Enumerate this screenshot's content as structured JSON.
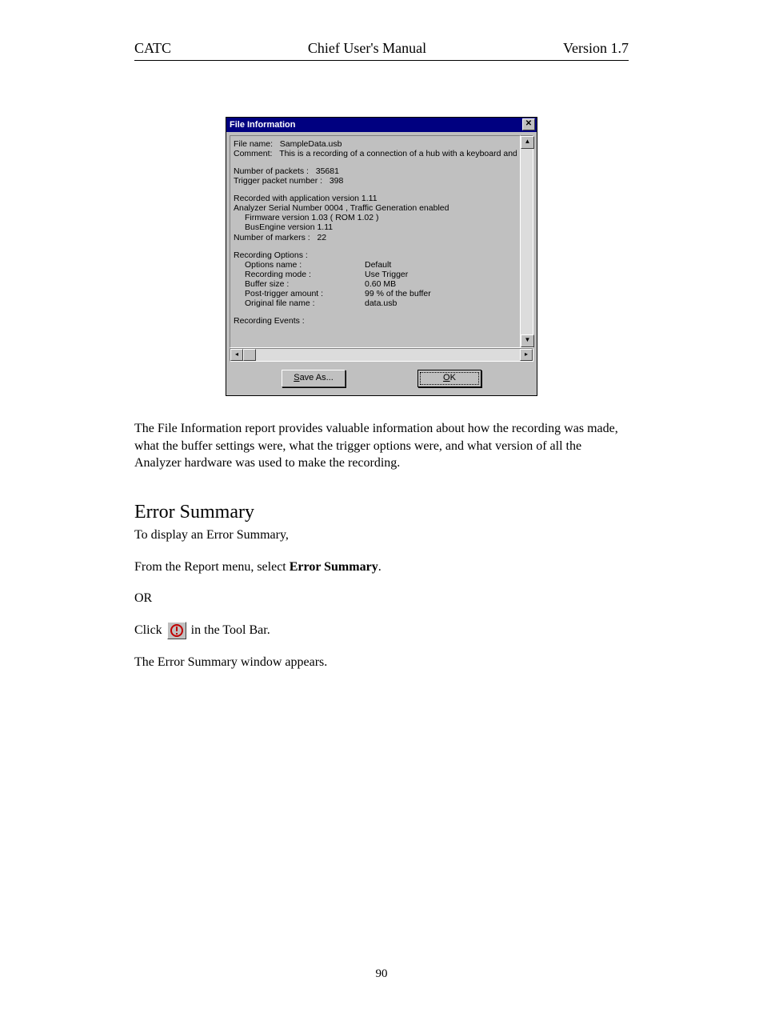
{
  "header": {
    "left": "CATC",
    "center": "Chief User's Manual",
    "right": "Version 1.7"
  },
  "dialog": {
    "title": "File Information",
    "close_glyph": "✕",
    "file_name_label": "File name:",
    "file_name_value": "SampleData.usb",
    "comment_label": "Comment:",
    "comment_value": "This is a recording of a connection of a hub with a keyboard and M",
    "num_packets_label": "Number of packets :",
    "num_packets_value": "35681",
    "trigger_packet_label": "Trigger packet number :",
    "trigger_packet_value": "398",
    "recorded_with": "Recorded with application version 1.11",
    "analyzer_serial": "Analyzer Serial Number 0004 ,  Traffic Generation enabled",
    "firmware": "Firmware version 1.03 ( ROM 1.02 )",
    "busengine": "BusEngine version 1.11",
    "num_markers_label": "Number of markers :",
    "num_markers_value": "22",
    "rec_options_header": "Recording Options :",
    "opt_options_name_label": "Options name :",
    "opt_options_name_value": "Default",
    "opt_recording_mode_label": "Recording mode :",
    "opt_recording_mode_value": "Use Trigger",
    "opt_buffer_size_label": "Buffer size :",
    "opt_buffer_size_value": "0.60 MB",
    "opt_post_trigger_label": "Post-trigger amount :",
    "opt_post_trigger_value": "99 % of the buffer",
    "opt_orig_file_label": "Original file name :",
    "opt_orig_file_value": "data.usb",
    "rec_events_header": "Recording Events :",
    "btn_save_as_prefix": "S",
    "btn_save_as_rest": "ave As...",
    "btn_ok_prefix": "O",
    "btn_ok_rest": "K",
    "scroll_up": "▲",
    "scroll_down": "▼",
    "scroll_left": "◂",
    "scroll_right": "▸"
  },
  "body": {
    "para1": "The File Information report provides valuable information about how the recording was made, what the buffer settings were, what the trigger options were, and what version of all the Analyzer hardware was used to make the recording.",
    "section_title": "Error Summary",
    "para2": "To display an Error Summary,",
    "para3_prefix": "From the Report menu, select ",
    "para3_bold": "Error Summary",
    "para3_suffix": ".",
    "or": "OR",
    "click_prefix": "Click ",
    "click_suffix": " in the Tool Bar.",
    "para4": "The Error Summary window appears."
  },
  "footer": {
    "page_number": "90"
  }
}
